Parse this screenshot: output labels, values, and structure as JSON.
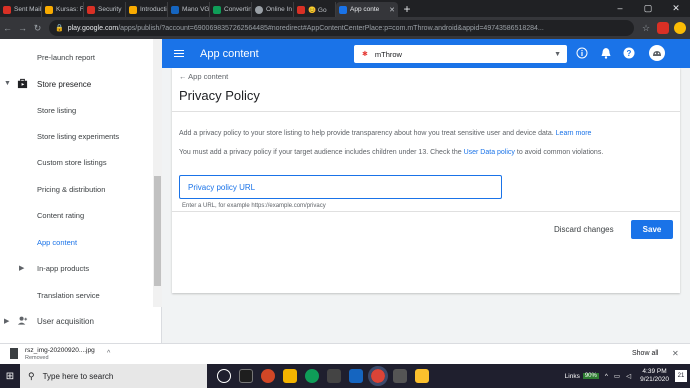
{
  "browser": {
    "tabs": [
      {
        "label": "Sent Mail",
        "favicon_color": "#d93025"
      },
      {
        "label": "Kursas: F",
        "favicon_color": "#f9ab00"
      },
      {
        "label": "Security",
        "favicon_color": "#d93025"
      },
      {
        "label": "Introducti",
        "favicon_color": "#f9ab00"
      },
      {
        "label": "Mano VG",
        "favicon_color": "#1565c0"
      },
      {
        "label": "Convertin",
        "favicon_color": "#0f9d58"
      },
      {
        "label": "Online In",
        "favicon_color": "#9aa0a6"
      },
      {
        "label": "😊 Go",
        "favicon_color": "#d93025"
      },
      {
        "label": "App conte",
        "favicon_color": "#1a73e8"
      }
    ],
    "new_tab": "+",
    "window_controls": [
      "–",
      "▢",
      "✕"
    ],
    "url_host": "play.google.com",
    "url_path": "/apps/publish/?account=6900698357262564485#noredirect#AppContentCenterPlace:p=com.mThrow.android&appid=49743586518284..."
  },
  "sidebar": {
    "items": [
      {
        "label": "Pre-launch report"
      },
      {
        "label": "Store presence"
      },
      {
        "label": "Store listing"
      },
      {
        "label": "Store listing experiments"
      },
      {
        "label": "Custom store listings"
      },
      {
        "label": "Pricing & distribution"
      },
      {
        "label": "Content rating"
      },
      {
        "label": "App content"
      },
      {
        "label": "In-app products"
      },
      {
        "label": "Translation service"
      },
      {
        "label": "User acquisition"
      }
    ]
  },
  "header": {
    "title": "App content",
    "app_name": "mThrow"
  },
  "content": {
    "back_label": "App content",
    "page_title": "Privacy Policy",
    "desc1_text": "Add a privacy policy to your store listing to help provide transparency about how you treat sensitive user and device data. ",
    "desc1_link": "Learn more",
    "desc2_pre": "You must add a privacy policy if your target audience includes children under 13. Check the ",
    "desc2_link": "User Data policy",
    "desc2_post": " to avoid common violations.",
    "input_placeholder": "Privacy policy URL",
    "input_value": "",
    "helper_text": "Enter a URL, for example https://example.com/privacy",
    "discard_label": "Discard changes",
    "save_label": "Save"
  },
  "downloads": {
    "file_name": "rsz_img-20200920....jpg",
    "status": "Removed",
    "show_all": "Show all"
  },
  "taskbar": {
    "search_placeholder": "Type here to search",
    "links_label": "Links",
    "battery": "90%",
    "time": "4:39 PM",
    "date": "9/21/2020",
    "notification_count": "21"
  },
  "colors": {
    "accent": "#1a73e8",
    "app_icon": "#e53935"
  }
}
